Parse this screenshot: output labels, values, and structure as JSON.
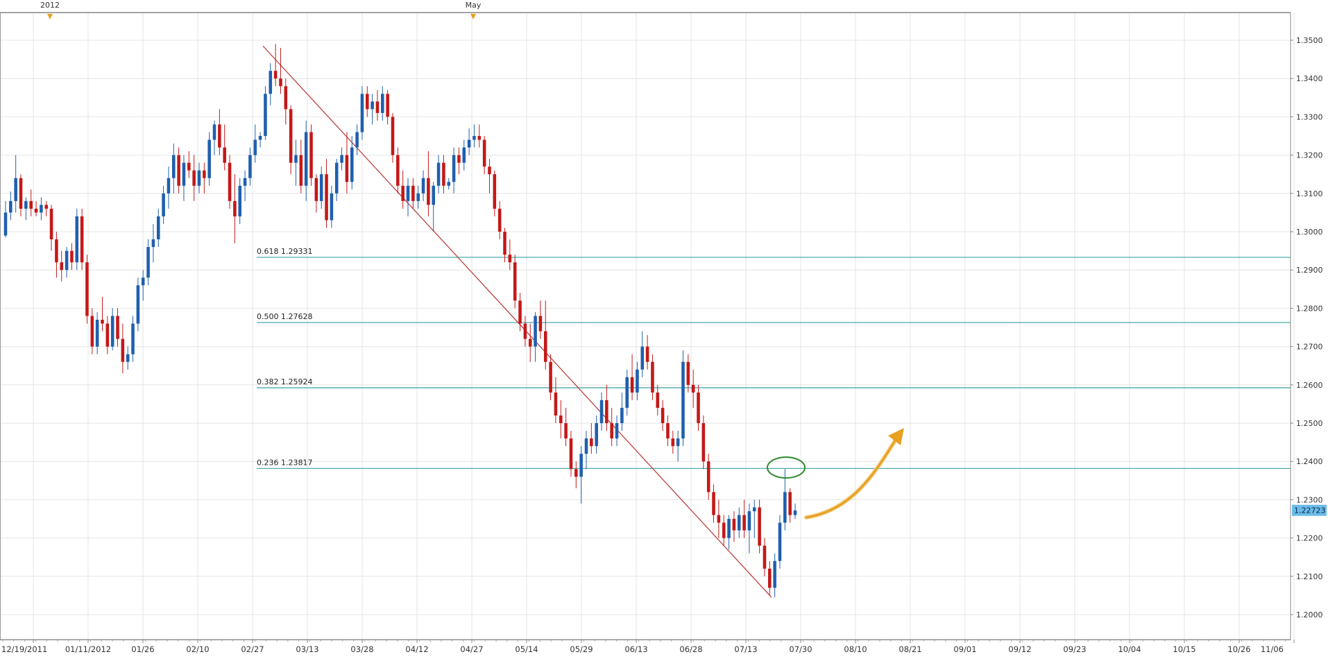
{
  "chart_data": {
    "type": "candlestick",
    "title": "",
    "xlabel": "",
    "ylabel": "",
    "ylim": [
      1.193,
      1.36
    ],
    "grid": true,
    "top_markers": [
      "2012",
      "May"
    ],
    "x_tick_labels": [
      "12/19/2011",
      "01/11/2012",
      "01/26",
      "02/10",
      "02/27",
      "03/13",
      "03/28",
      "04/12",
      "04/27",
      "05/14",
      "05/29",
      "06/13",
      "06/28",
      "07/13",
      "07/30",
      "08/10",
      "08/21",
      "09/01",
      "09/12",
      "09/23",
      "10/04",
      "10/15",
      "10/26",
      "11/06"
    ],
    "y_tick_labels": [
      "1.3500",
      "1.3400",
      "1.3300",
      "1.3200",
      "1.3100",
      "1.3000",
      "1.2900",
      "1.2800",
      "1.2700",
      "1.2600",
      "1.2500",
      "1.2400",
      "1.2300",
      "1.2200",
      "1.2100",
      "1.2000"
    ],
    "current_price": "1.22723",
    "colors": {
      "up": "#1f5fae",
      "down": "#c41818",
      "fib": "#3aa0a0",
      "trend": "#b83333",
      "arrow": "#e8a020",
      "ellipse": "#2e8b2e",
      "price_tag": "#6bbbe8"
    },
    "fib_levels": [
      {
        "label": "0.618 1.29331",
        "value": 1.29331
      },
      {
        "label": "0.500 1.27628",
        "value": 1.27628
      },
      {
        "label": "0.382 1.25924",
        "value": 1.25924
      },
      {
        "label": "0.236 1.23817",
        "value": 1.23817
      }
    ],
    "trendline": {
      "from_date": "02/27",
      "from_value": 1.3485,
      "to_date": "07/24",
      "to_value": 1.2045
    },
    "candles_note": "approximate daily OHLC read from chart, Dec 2011 - Aug 2012",
    "candles": [
      [
        1.299,
        1.308,
        1.2985,
        1.305
      ],
      [
        1.305,
        1.3105,
        1.303,
        1.308
      ],
      [
        1.308,
        1.32,
        1.305,
        1.314
      ],
      [
        1.314,
        1.315,
        1.304,
        1.306
      ],
      [
        1.306,
        1.309,
        1.303,
        1.308
      ],
      [
        1.308,
        1.311,
        1.304,
        1.306
      ],
      [
        1.306,
        1.308,
        1.304,
        1.305
      ],
      [
        1.305,
        1.309,
        1.303,
        1.307
      ],
      [
        1.307,
        1.308,
        1.304,
        1.306
      ],
      [
        1.306,
        1.307,
        1.295,
        1.298
      ],
      [
        1.298,
        1.3,
        1.288,
        1.292
      ],
      [
        1.292,
        1.295,
        1.287,
        1.29
      ],
      [
        1.29,
        1.296,
        1.288,
        1.295
      ],
      [
        1.295,
        1.297,
        1.29,
        1.292
      ],
      [
        1.292,
        1.306,
        1.29,
        1.304
      ],
      [
        1.304,
        1.306,
        1.29,
        1.292
      ],
      [
        1.292,
        1.294,
        1.276,
        1.278
      ],
      [
        1.278,
        1.28,
        1.268,
        1.27
      ],
      [
        1.27,
        1.279,
        1.268,
        1.277
      ],
      [
        1.277,
        1.283,
        1.274,
        1.276
      ],
      [
        1.276,
        1.278,
        1.268,
        1.27
      ],
      [
        1.27,
        1.28,
        1.269,
        1.278
      ],
      [
        1.278,
        1.28,
        1.27,
        1.272
      ],
      [
        1.272,
        1.276,
        1.263,
        1.266
      ],
      [
        1.266,
        1.27,
        1.264,
        1.268
      ],
      [
        1.268,
        1.278,
        1.266,
        1.276
      ],
      [
        1.276,
        1.288,
        1.274,
        1.286
      ],
      [
        1.286,
        1.29,
        1.282,
        1.288
      ],
      [
        1.288,
        1.298,
        1.286,
        1.296
      ],
      [
        1.296,
        1.302,
        1.292,
        1.298
      ],
      [
        1.298,
        1.306,
        1.296,
        1.304
      ],
      [
        1.304,
        1.312,
        1.302,
        1.31
      ],
      [
        1.31,
        1.317,
        1.306,
        1.314
      ],
      [
        1.314,
        1.323,
        1.31,
        1.32
      ],
      [
        1.32,
        1.322,
        1.31,
        1.312
      ],
      [
        1.312,
        1.32,
        1.308,
        1.318
      ],
      [
        1.318,
        1.321,
        1.314,
        1.316
      ],
      [
        1.316,
        1.32,
        1.308,
        1.312
      ],
      [
        1.312,
        1.318,
        1.31,
        1.316
      ],
      [
        1.316,
        1.318,
        1.31,
        1.314
      ],
      [
        1.314,
        1.326,
        1.312,
        1.324
      ],
      [
        1.324,
        1.329,
        1.32,
        1.328
      ],
      [
        1.328,
        1.332,
        1.32,
        1.322
      ],
      [
        1.322,
        1.328,
        1.316,
        1.318
      ],
      [
        1.318,
        1.32,
        1.306,
        1.308
      ],
      [
        1.308,
        1.315,
        1.297,
        1.304
      ],
      [
        1.304,
        1.314,
        1.302,
        1.312
      ],
      [
        1.312,
        1.316,
        1.308,
        1.314
      ],
      [
        1.314,
        1.322,
        1.312,
        1.32
      ],
      [
        1.32,
        1.328,
        1.318,
        1.324
      ],
      [
        1.324,
        1.326,
        1.322,
        1.325
      ],
      [
        1.325,
        1.338,
        1.324,
        1.336
      ],
      [
        1.336,
        1.344,
        1.333,
        1.342
      ],
      [
        1.342,
        1.349,
        1.338,
        1.34
      ],
      [
        1.34,
        1.348,
        1.336,
        1.338
      ],
      [
        1.338,
        1.34,
        1.328,
        1.332
      ],
      [
        1.332,
        1.333,
        1.315,
        1.318
      ],
      [
        1.318,
        1.324,
        1.312,
        1.32
      ],
      [
        1.32,
        1.324,
        1.31,
        1.312
      ],
      [
        1.312,
        1.329,
        1.308,
        1.326
      ],
      [
        1.326,
        1.328,
        1.312,
        1.314
      ],
      [
        1.314,
        1.315,
        1.305,
        1.308
      ],
      [
        1.308,
        1.317,
        1.306,
        1.315
      ],
      [
        1.315,
        1.319,
        1.301,
        1.303
      ],
      [
        1.303,
        1.312,
        1.301,
        1.31
      ],
      [
        1.31,
        1.319,
        1.308,
        1.318
      ],
      [
        1.318,
        1.322,
        1.316,
        1.32
      ],
      [
        1.32,
        1.326,
        1.31,
        1.313
      ],
      [
        1.313,
        1.325,
        1.311,
        1.322
      ],
      [
        1.322,
        1.328,
        1.32,
        1.326
      ],
      [
        1.326,
        1.338,
        1.324,
        1.336
      ],
      [
        1.336,
        1.338,
        1.33,
        1.332
      ],
      [
        1.332,
        1.336,
        1.328,
        1.334
      ],
      [
        1.334,
        1.337,
        1.329,
        1.331
      ],
      [
        1.331,
        1.338,
        1.329,
        1.336
      ],
      [
        1.336,
        1.337,
        1.328,
        1.33
      ],
      [
        1.33,
        1.331,
        1.318,
        1.32
      ],
      [
        1.32,
        1.322,
        1.31,
        1.312
      ],
      [
        1.312,
        1.316,
        1.306,
        1.308
      ],
      [
        1.308,
        1.314,
        1.304,
        1.312
      ],
      [
        1.312,
        1.314,
        1.306,
        1.308
      ],
      [
        1.308,
        1.312,
        1.306,
        1.31
      ],
      [
        1.31,
        1.316,
        1.308,
        1.314
      ],
      [
        1.314,
        1.321,
        1.304,
        1.307
      ],
      [
        1.307,
        1.313,
        1.3,
        1.312
      ],
      [
        1.312,
        1.32,
        1.31,
        1.318
      ],
      [
        1.318,
        1.32,
        1.31,
        1.312
      ],
      [
        1.312,
        1.314,
        1.311,
        1.313
      ],
      [
        1.313,
        1.322,
        1.31,
        1.32
      ],
      [
        1.32,
        1.322,
        1.315,
        1.318
      ],
      [
        1.318,
        1.324,
        1.316,
        1.322
      ],
      [
        1.322,
        1.327,
        1.32,
        1.324
      ],
      [
        1.324,
        1.328,
        1.322,
        1.325
      ],
      [
        1.325,
        1.328,
        1.322,
        1.324
      ],
      [
        1.324,
        1.325,
        1.315,
        1.317
      ],
      [
        1.317,
        1.319,
        1.31,
        1.315
      ],
      [
        1.315,
        1.316,
        1.304,
        1.306
      ],
      [
        1.306,
        1.308,
        1.298,
        1.3
      ],
      [
        1.3,
        1.301,
        1.292,
        1.294
      ],
      [
        1.294,
        1.298,
        1.29,
        1.292
      ],
      [
        1.292,
        1.294,
        1.28,
        1.282
      ],
      [
        1.282,
        1.284,
        1.274,
        1.276
      ],
      [
        1.276,
        1.278,
        1.27,
        1.272
      ],
      [
        1.272,
        1.276,
        1.266,
        1.27
      ],
      [
        1.27,
        1.279,
        1.266,
        1.278
      ],
      [
        1.278,
        1.282,
        1.272,
        1.274
      ],
      [
        1.274,
        1.282,
        1.264,
        1.266
      ],
      [
        1.266,
        1.268,
        1.256,
        1.258
      ],
      [
        1.258,
        1.262,
        1.25,
        1.252
      ],
      [
        1.252,
        1.256,
        1.246,
        1.25
      ],
      [
        1.25,
        1.254,
        1.244,
        1.246
      ],
      [
        1.246,
        1.248,
        1.236,
        1.238
      ],
      [
        1.238,
        1.24,
        1.233,
        1.236
      ],
      [
        1.236,
        1.244,
        1.229,
        1.242
      ],
      [
        1.242,
        1.248,
        1.238,
        1.246
      ],
      [
        1.246,
        1.25,
        1.242,
        1.244
      ],
      [
        1.244,
        1.252,
        1.242,
        1.25
      ],
      [
        1.25,
        1.258,
        1.248,
        1.256
      ],
      [
        1.256,
        1.26,
        1.248,
        1.25
      ],
      [
        1.25,
        1.254,
        1.244,
        1.246
      ],
      [
        1.246,
        1.252,
        1.244,
        1.25
      ],
      [
        1.25,
        1.258,
        1.248,
        1.254
      ],
      [
        1.254,
        1.264,
        1.252,
        1.262
      ],
      [
        1.262,
        1.268,
        1.256,
        1.258
      ],
      [
        1.258,
        1.266,
        1.256,
        1.264
      ],
      [
        1.264,
        1.274,
        1.262,
        1.27
      ],
      [
        1.27,
        1.273,
        1.264,
        1.266
      ],
      [
        1.266,
        1.268,
        1.256,
        1.258
      ],
      [
        1.258,
        1.26,
        1.252,
        1.254
      ],
      [
        1.254,
        1.256,
        1.248,
        1.25
      ],
      [
        1.25,
        1.252,
        1.244,
        1.246
      ],
      [
        1.246,
        1.248,
        1.242,
        1.244
      ],
      [
        1.244,
        1.248,
        1.24,
        1.246
      ],
      [
        1.246,
        1.269,
        1.244,
        1.266
      ],
      [
        1.266,
        1.268,
        1.258,
        1.26
      ],
      [
        1.26,
        1.264,
        1.254,
        1.258
      ],
      [
        1.258,
        1.26,
        1.248,
        1.25
      ],
      [
        1.25,
        1.252,
        1.238,
        1.24
      ],
      [
        1.24,
        1.242,
        1.23,
        1.232
      ],
      [
        1.232,
        1.234,
        1.224,
        1.226
      ],
      [
        1.226,
        1.23,
        1.22,
        1.224
      ],
      [
        1.224,
        1.226,
        1.218,
        1.22
      ],
      [
        1.22,
        1.226,
        1.217,
        1.225
      ],
      [
        1.225,
        1.227,
        1.219,
        1.222
      ],
      [
        1.222,
        1.228,
        1.22,
        1.226
      ],
      [
        1.226,
        1.23,
        1.22,
        1.222
      ],
      [
        1.222,
        1.229,
        1.216,
        1.227
      ],
      [
        1.227,
        1.23,
        1.22,
        1.228
      ],
      [
        1.228,
        1.23,
        1.216,
        1.218
      ],
      [
        1.218,
        1.22,
        1.21,
        1.212
      ],
      [
        1.212,
        1.214,
        1.205,
        1.207
      ],
      [
        1.207,
        1.216,
        1.2045,
        1.214
      ],
      [
        1.214,
        1.226,
        1.212,
        1.224
      ],
      [
        1.224,
        1.238,
        1.222,
        1.232
      ],
      [
        1.232,
        1.233,
        1.224,
        1.226
      ],
      [
        1.226,
        1.229,
        1.225,
        1.2272
      ]
    ]
  }
}
